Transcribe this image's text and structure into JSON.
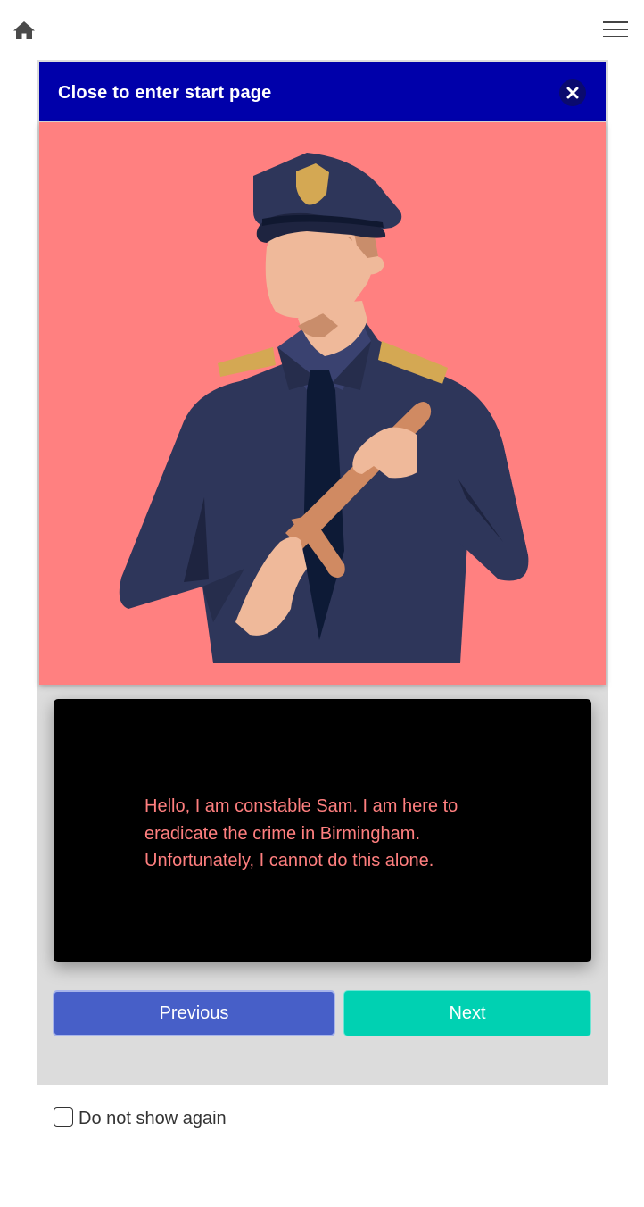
{
  "topbar": {
    "home_icon": "home-icon",
    "menu_icon": "hamburger-menu-icon"
  },
  "modal": {
    "title": "Close to enter start page",
    "close_icon": "close-icon",
    "header_color": "#0000aa",
    "illustration": {
      "background": "#ff8080",
      "uniform_color": "#2e365a"
    },
    "message": "Hello, I am constable Sam. I am here to eradicate the crime in Birmingham. Unfortunately, I cannot do this alone.",
    "message_color": "#ff7f7f",
    "buttons": {
      "previous": "Previous",
      "next": "Next",
      "previous_color": "#475fc8",
      "next_color": "#00d1b2"
    }
  },
  "footer": {
    "checkbox_label": "Do not show again",
    "checked": false
  }
}
